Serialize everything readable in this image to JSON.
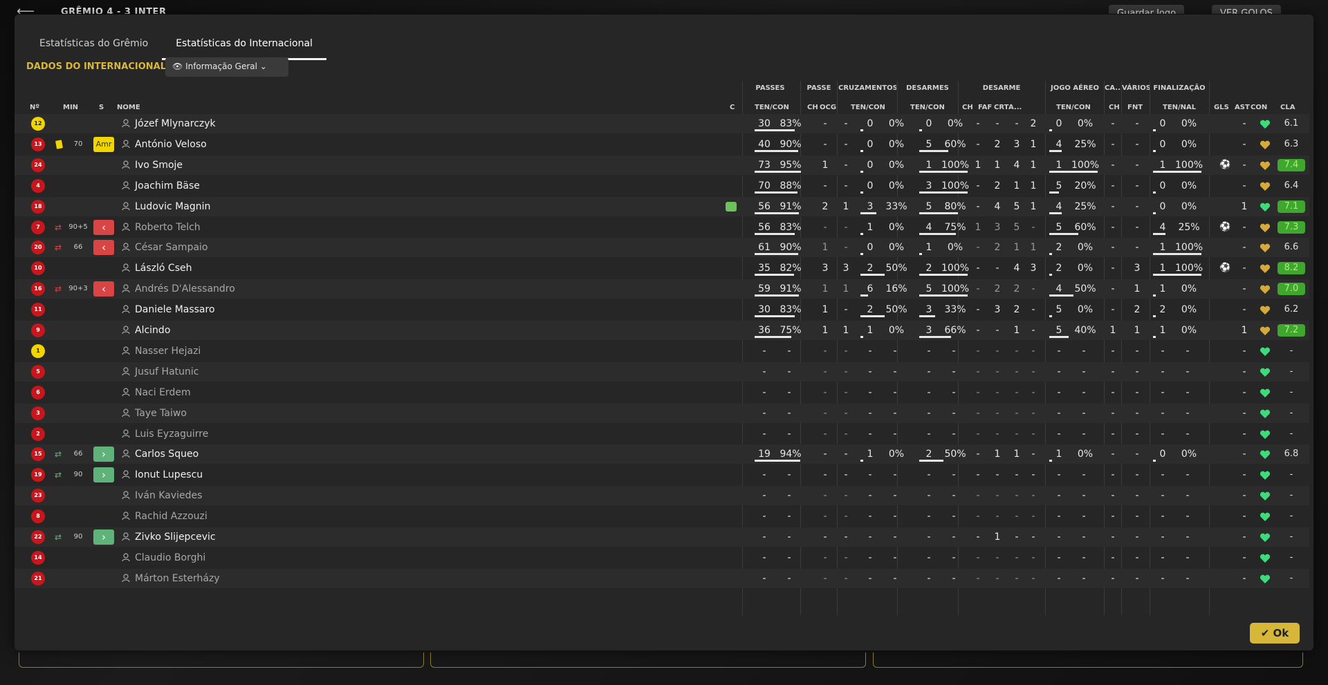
{
  "header": {
    "back_icon": "arrow-left-icon",
    "match": "GRÊMIO  4 - 3  INTER",
    "save_label": "Guardar Jogo",
    "goals_label": "VER GOLOS"
  },
  "tabs": [
    {
      "label": "Estatísticas do Grêmio"
    },
    {
      "label": "Estatísticas do Internacional"
    }
  ],
  "section_title": "DADOS DO INTERNACIONAL",
  "dropdown": {
    "label": "Informação Geral"
  },
  "groups": {
    "passes": "PASSES",
    "passe": "PASSE",
    "cruzamentos": "CRUZAMENTOS",
    "desarmes": "DESARMES",
    "desarme": "DESARME",
    "jogo_aereo": "JOGO AÉREO",
    "ca": "CA...",
    "varios": "VÁRIOS",
    "finalizacao": "FINALIZAÇÃO"
  },
  "cols": {
    "num": "Nº",
    "min": "MIN",
    "s": "S",
    "nome": "NOME",
    "c": "C",
    "pass_tc": "TEN/CON",
    "p_ch": "CH",
    "p_ocg": "OCG",
    "cru_tc": "TEN/CON",
    "des_tc": "TEN/CON",
    "d_ch": "CH",
    "d_faf": "FAF",
    "d_crt": "CRT",
    "d_a": "A...",
    "aer_tc": "TEN/CON",
    "ca_ch": "CH",
    "var_fnt": "FNT",
    "fin_tn": "TEN/NAL",
    "gls": "GLS",
    "ast": "AST",
    "con": "CON",
    "cla": "CLA"
  },
  "players": [
    {
      "num": "12",
      "gk": true,
      "name": "Józef Mlynarczyk",
      "min": "",
      "card": false,
      "swap": false,
      "s": "",
      "pass": [
        "30",
        "83%"
      ],
      "pch": "-",
      "pocg": "-",
      "cru": [
        "0",
        "0%"
      ],
      "des": [
        "0",
        "0%"
      ],
      "dch": "-",
      "dfaf": "-",
      "dcrt": "-",
      "da": "2",
      "aer": [
        "0",
        "0%"
      ],
      "cach": "-",
      "fnt": "-",
      "fin": [
        "0",
        "0%"
      ],
      "gls": "",
      "ast": "-",
      "cla": "6.1",
      "good": false,
      "sub": false
    },
    {
      "num": "13",
      "gk": false,
      "name": "António Veloso",
      "min": "70",
      "card": true,
      "swap": false,
      "s": "Amr",
      "pass": [
        "40",
        "90%"
      ],
      "pch": "-",
      "pocg": "-",
      "cru": [
        "0",
        "0%"
      ],
      "des": [
        "5",
        "60%"
      ],
      "dch": "-",
      "dfaf": "2",
      "dcrt": "3",
      "da": "1",
      "aer": [
        "4",
        "25%"
      ],
      "cach": "-",
      "fnt": "-",
      "fin": [
        "0",
        "0%"
      ],
      "gls": "",
      "ast": "-",
      "cla": "6.3",
      "good": false,
      "sub": false
    },
    {
      "num": "24",
      "gk": false,
      "name": "Ivo Smoje",
      "min": "",
      "card": false,
      "swap": false,
      "s": "",
      "pass": [
        "73",
        "95%"
      ],
      "pch": "1",
      "pocg": "-",
      "cru": [
        "0",
        "0%"
      ],
      "des": [
        "1",
        "100%"
      ],
      "dch": "1",
      "dfaf": "1",
      "dcrt": "4",
      "da": "1",
      "aer": [
        "1",
        "100%"
      ],
      "cach": "-",
      "fnt": "-",
      "fin": [
        "1",
        "100%"
      ],
      "gls": "goal",
      "ast": "-",
      "cla": "7.4",
      "good": true,
      "sub": false
    },
    {
      "num": "4",
      "gk": false,
      "name": "Joachim Bäse",
      "min": "",
      "card": false,
      "swap": false,
      "s": "",
      "pass": [
        "70",
        "88%"
      ],
      "pch": "-",
      "pocg": "-",
      "cru": [
        "0",
        "0%"
      ],
      "des": [
        "3",
        "100%"
      ],
      "dch": "-",
      "dfaf": "2",
      "dcrt": "1",
      "da": "1",
      "aer": [
        "5",
        "20%"
      ],
      "cach": "-",
      "fnt": "-",
      "fin": [
        "0",
        "0%"
      ],
      "gls": "",
      "ast": "-",
      "cla": "6.4",
      "good": false,
      "sub": false
    },
    {
      "num": "18",
      "gk": false,
      "name": "Ludovic Magnin",
      "min": "",
      "card": false,
      "swap": false,
      "s": "",
      "pass": [
        "56",
        "91%"
      ],
      "pch": "2",
      "pocg": "1",
      "cru": [
        "3",
        "33%"
      ],
      "des": [
        "5",
        "80%"
      ],
      "dch": "-",
      "dfaf": "4",
      "dcrt": "5",
      "da": "1",
      "aer": [
        "4",
        "25%"
      ],
      "cach": "-",
      "fnt": "-",
      "fin": [
        "0",
        "0%"
      ],
      "gls": "",
      "ast": "1",
      "cla": "7.1",
      "good": true,
      "sub": false,
      "fit": true
    },
    {
      "num": "7",
      "gk": false,
      "name": "Roberto Telch",
      "min": "90+5",
      "card": false,
      "swap": true,
      "s": "out",
      "pass": [
        "56",
        "83%"
      ],
      "pch": "-",
      "pocg": "-",
      "cru": [
        "1",
        "0%"
      ],
      "des": [
        "4",
        "75%"
      ],
      "dch": "1",
      "dfaf": "3",
      "dcrt": "5",
      "da": "-",
      "aer": [
        "5",
        "60%"
      ],
      "cach": "-",
      "fnt": "-",
      "fin": [
        "4",
        "25%"
      ],
      "gls": "goal",
      "ast": "-",
      "cla": "7.3",
      "good": true,
      "sub": true
    },
    {
      "num": "20",
      "gk": false,
      "name": "César Sampaio",
      "min": "66",
      "card": false,
      "swap": true,
      "s": "out",
      "pass": [
        "61",
        "90%"
      ],
      "pch": "1",
      "pocg": "-",
      "cru": [
        "0",
        "0%"
      ],
      "des": [
        "1",
        "0%"
      ],
      "dch": "-",
      "dfaf": "2",
      "dcrt": "1",
      "da": "1",
      "aer": [
        "2",
        "0%"
      ],
      "cach": "-",
      "fnt": "-",
      "fin": [
        "1",
        "100%"
      ],
      "gls": "",
      "ast": "-",
      "cla": "6.6",
      "good": false,
      "sub": true
    },
    {
      "num": "10",
      "gk": false,
      "name": "László Cseh",
      "min": "",
      "card": false,
      "swap": false,
      "s": "",
      "pass": [
        "35",
        "82%"
      ],
      "pch": "3",
      "pocg": "3",
      "cru": [
        "2",
        "50%"
      ],
      "des": [
        "2",
        "100%"
      ],
      "dch": "-",
      "dfaf": "-",
      "dcrt": "4",
      "da": "3",
      "aer": [
        "2",
        "0%"
      ],
      "cach": "-",
      "fnt": "3",
      "fin": [
        "1",
        "100%"
      ],
      "gls": "goal",
      "ast": "-",
      "cla": "8.2",
      "good": true,
      "sub": false
    },
    {
      "num": "16",
      "gk": false,
      "name": "Andrés D'Alessandro",
      "min": "90+3",
      "card": false,
      "swap": true,
      "s": "out",
      "pass": [
        "59",
        "91%"
      ],
      "pch": "1",
      "pocg": "1",
      "cru": [
        "6",
        "16%"
      ],
      "des": [
        "5",
        "100%"
      ],
      "dch": "-",
      "dfaf": "2",
      "dcrt": "2",
      "da": "-",
      "aer": [
        "4",
        "50%"
      ],
      "cach": "-",
      "fnt": "1",
      "fin": [
        "1",
        "0%"
      ],
      "gls": "",
      "ast": "-",
      "cla": "7.0",
      "good": true,
      "sub": true
    },
    {
      "num": "11",
      "gk": false,
      "name": "Daniele Massaro",
      "min": "",
      "card": false,
      "swap": false,
      "s": "",
      "pass": [
        "30",
        "83%"
      ],
      "pch": "1",
      "pocg": "-",
      "cru": [
        "2",
        "50%"
      ],
      "des": [
        "3",
        "33%"
      ],
      "dch": "-",
      "dfaf": "3",
      "dcrt": "2",
      "da": "-",
      "aer": [
        "5",
        "0%"
      ],
      "cach": "-",
      "fnt": "2",
      "fin": [
        "2",
        "0%"
      ],
      "gls": "",
      "ast": "-",
      "cla": "6.2",
      "good": false,
      "sub": false
    },
    {
      "num": "9",
      "gk": false,
      "name": "Alcindo",
      "min": "",
      "card": false,
      "swap": false,
      "s": "",
      "pass": [
        "36",
        "75%"
      ],
      "pch": "1",
      "pocg": "1",
      "cru": [
        "1",
        "0%"
      ],
      "des": [
        "3",
        "66%"
      ],
      "dch": "-",
      "dfaf": "-",
      "dcrt": "1",
      "da": "-",
      "aer": [
        "5",
        "40%"
      ],
      "cach": "1",
      "fnt": "1",
      "fin": [
        "1",
        "0%"
      ],
      "gls": "",
      "ast": "1",
      "cla": "7.2",
      "good": true,
      "sub": false
    },
    {
      "num": "1",
      "gk": true,
      "name": "Nasser Hejazi",
      "blank": true,
      "sub": true
    },
    {
      "num": "5",
      "gk": false,
      "name": "Jusuf Hatunic",
      "blank": true,
      "sub": true
    },
    {
      "num": "6",
      "gk": false,
      "name": "Naci Erdem",
      "blank": true,
      "sub": true
    },
    {
      "num": "3",
      "gk": false,
      "name": "Taye Taiwo",
      "blank": true,
      "sub": true
    },
    {
      "num": "2",
      "gk": false,
      "name": "Luis Eyzaguirre",
      "blank": true,
      "sub": true
    },
    {
      "num": "15",
      "gk": false,
      "name": "Carlos Squeo",
      "min": "66",
      "card": false,
      "swap": true,
      "s": "in",
      "pass": [
        "19",
        "94%"
      ],
      "pch": "-",
      "pocg": "-",
      "cru": [
        "1",
        "0%"
      ],
      "des": [
        "2",
        "50%"
      ],
      "dch": "-",
      "dfaf": "1",
      "dcrt": "1",
      "da": "-",
      "aer": [
        "1",
        "0%"
      ],
      "cach": "-",
      "fnt": "-",
      "fin": [
        "0",
        "0%"
      ],
      "gls": "",
      "ast": "-",
      "cla": "6.8",
      "good": false,
      "sub": false
    },
    {
      "num": "19",
      "gk": false,
      "name": "Ionut Lupescu",
      "min": "90",
      "swap": true,
      "s": "in",
      "blank": true,
      "sub": false
    },
    {
      "num": "23",
      "gk": false,
      "name": "Iván Kaviedes",
      "blank": true,
      "sub": true
    },
    {
      "num": "8",
      "gk": false,
      "name": "Rachid Azzouzi",
      "blank": true,
      "sub": true
    },
    {
      "num": "22",
      "gk": false,
      "name": "Zivko Slijepcevic",
      "min": "90",
      "swap": true,
      "s": "in",
      "blank": true,
      "sub": false,
      "dfaf": "1"
    },
    {
      "num": "14",
      "gk": false,
      "name": "Claudio Borghi",
      "blank": true,
      "sub": true
    },
    {
      "num": "21",
      "gk": false,
      "name": "Márton Esterházy",
      "blank": true,
      "sub": true
    }
  ],
  "ok_label": "Ok",
  "colors": {
    "accent": "#d9b73c",
    "good": "#3fa62e",
    "out": "#d94545",
    "in": "#5fb37a"
  }
}
